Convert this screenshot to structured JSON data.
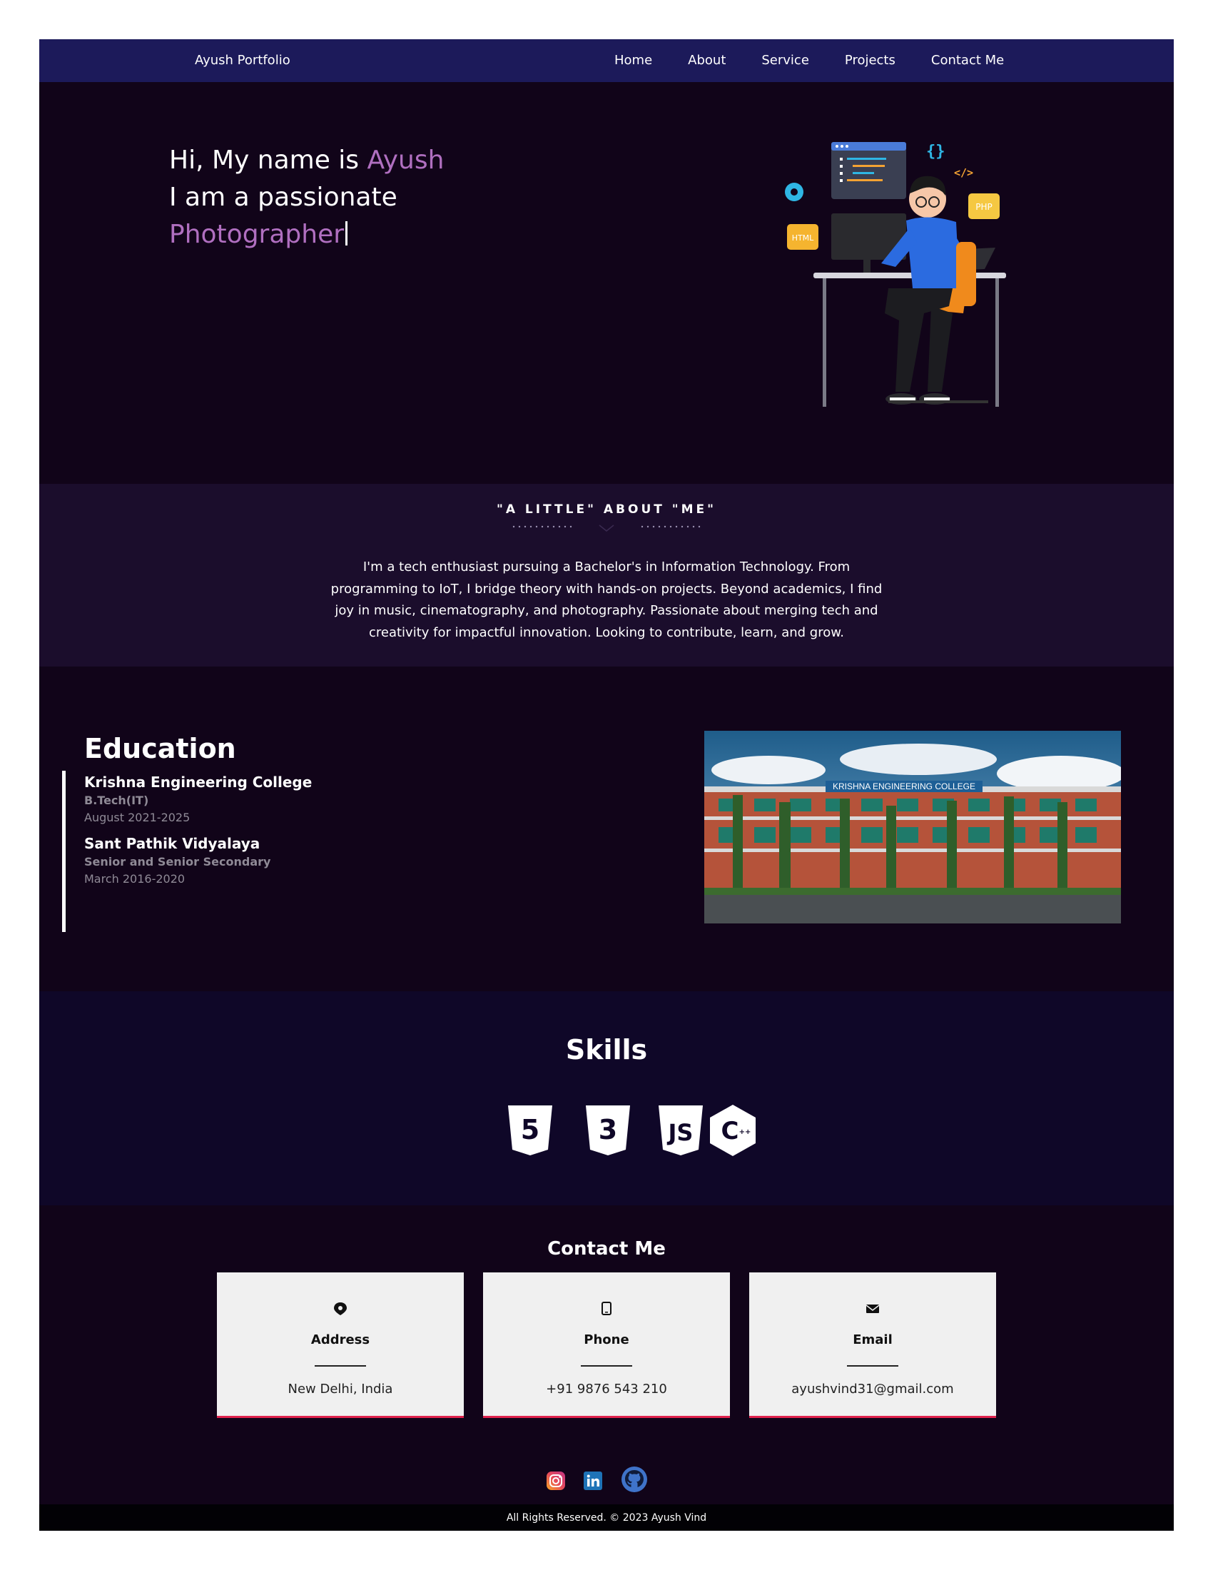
{
  "nav": {
    "brand": "Ayush Portfolio",
    "links": [
      "Home",
      "About",
      "Service",
      "Projects",
      "Contact Me"
    ]
  },
  "hero": {
    "line1_prefix": "Hi, My name is ",
    "name": "Ayush",
    "line2": "I am a passionate",
    "role": "Photographer",
    "illustration_labels": {
      "braces": "{}",
      "code_tag": "</>",
      "php": "PHP",
      "html": "HTML"
    }
  },
  "about": {
    "title": "\"A LITTLE\" ABOUT \"ME\"",
    "text": "I'm a tech enthusiast pursuing a Bachelor's in Information Technology. From programming to IoT, I bridge theory with hands-on projects. Beyond academics, I find joy in music, cinematography, and photography. Passionate about merging tech and creativity for impactful innovation. Looking to contribute, learn, and grow."
  },
  "education": {
    "title": "Education",
    "items": [
      {
        "school": "Krishna Engineering College",
        "degree": "B.Tech(IT)",
        "date": "August 2021-2025"
      },
      {
        "school": "Sant Pathik Vidyalaya",
        "degree": "Senior and Senior Secondary",
        "date": "March 2016-2020"
      }
    ],
    "photo_sign": "KRISHNA ENGINEERING COLLEGE"
  },
  "skills": {
    "title": "Skills",
    "icons": [
      "html5-icon",
      "css3-icon",
      "javascript-icon",
      "cplusplus-icon"
    ]
  },
  "contact": {
    "title": "Contact Me",
    "cards": [
      {
        "icon": "map-pin-icon",
        "title": "Address",
        "value": "New Delhi, India"
      },
      {
        "icon": "phone-icon",
        "title": "Phone",
        "value": "+91 9876 543 210"
      },
      {
        "icon": "envelope-icon",
        "title": "Email",
        "value": "ayushvind31@gmail.com"
      }
    ],
    "socials": [
      "instagram-icon",
      "linkedin-icon",
      "github-icon"
    ]
  },
  "footer": {
    "text": "All Rights Reserved. © 2023 Ayush Vind"
  },
  "colors": {
    "nav_bg": "#1c1a5a",
    "page_bg": "#110419",
    "about_bg": "#1b0d2c",
    "skills_bg": "#0f0728",
    "accent": "#b06fc0",
    "card_border": "#e0224d"
  }
}
